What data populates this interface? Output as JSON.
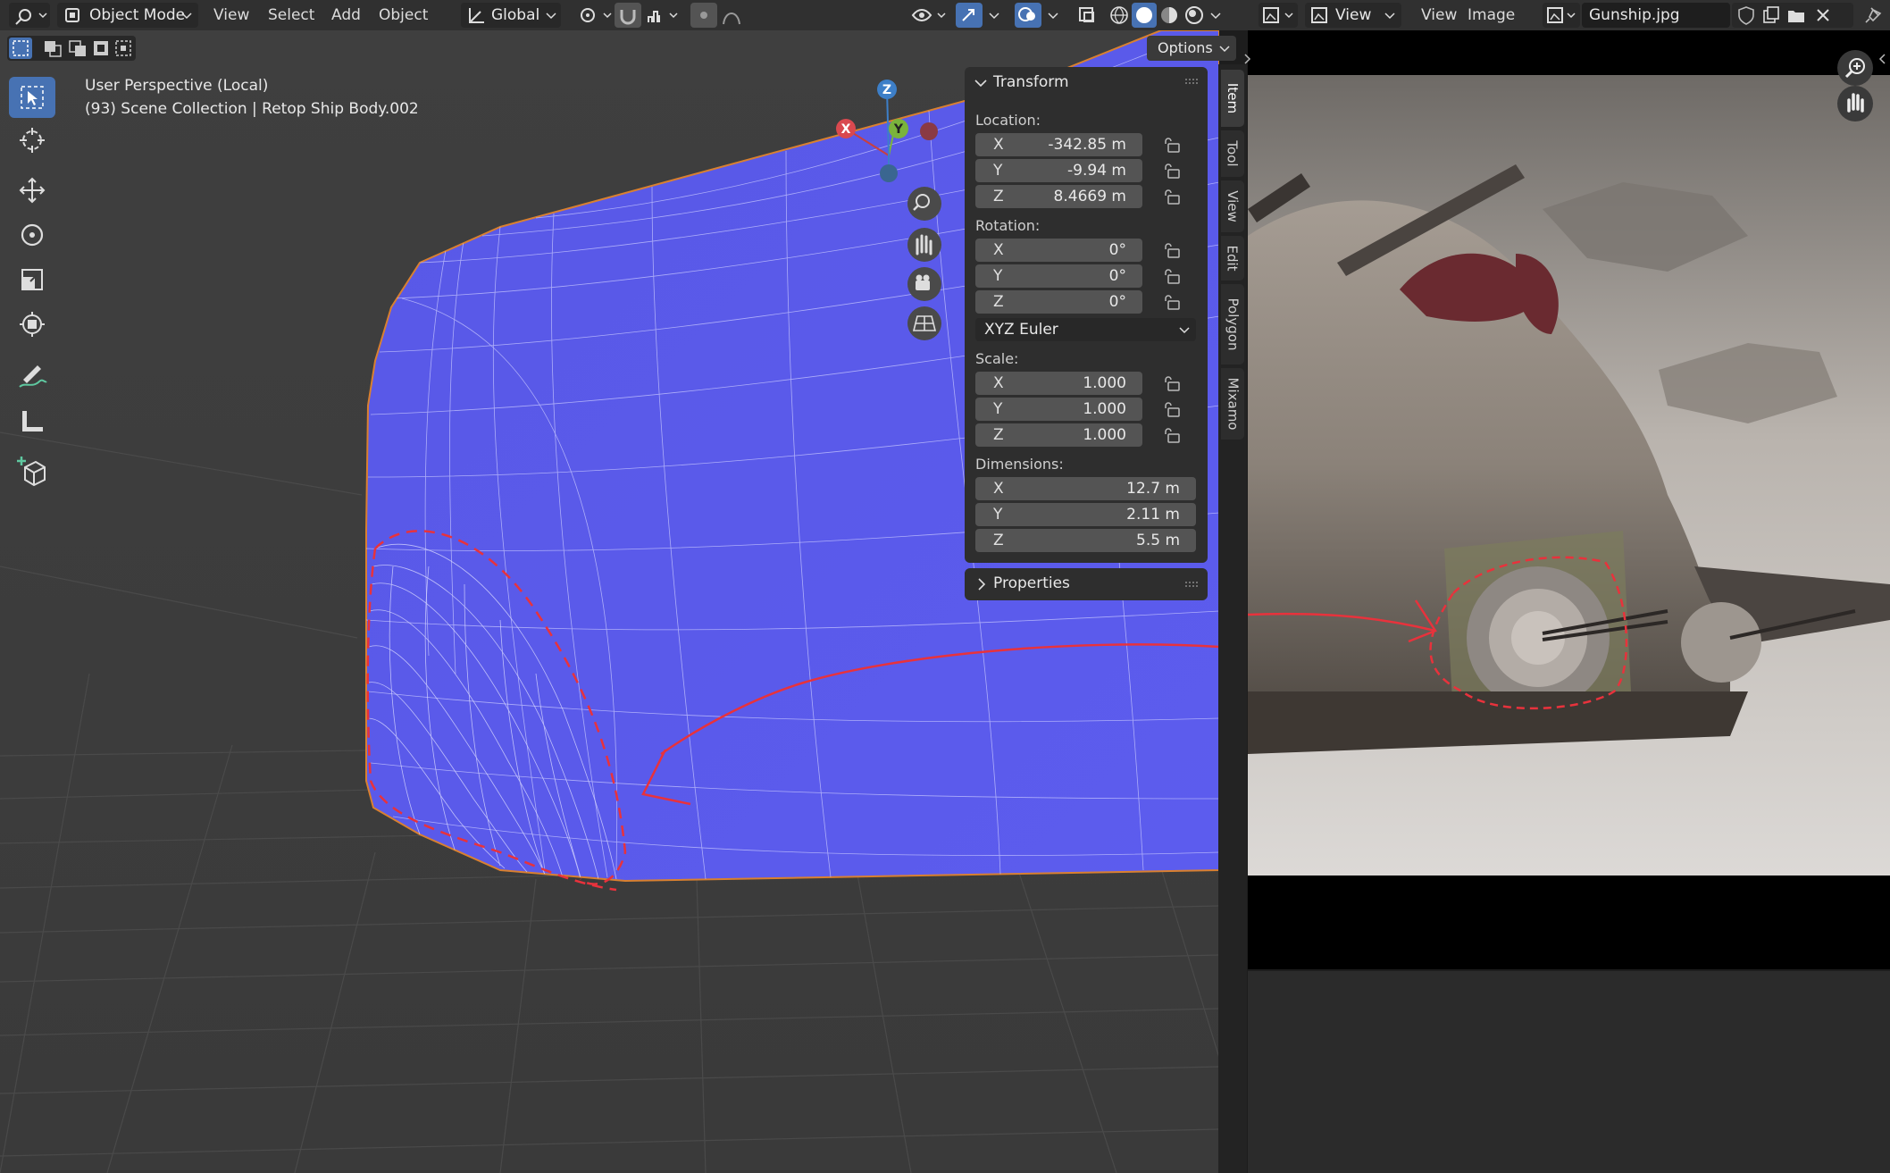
{
  "header": {
    "mode": "Object Mode",
    "menu": [
      "View",
      "Select",
      "Add",
      "Object"
    ],
    "orientation": "Global"
  },
  "viewport": {
    "perspective": "User Perspective (Local)",
    "collection": "(93) Scene Collection | Retop Ship Body.002",
    "options_label": "Options",
    "gizmo": {
      "x": "X",
      "y": "Y",
      "z": "Z"
    }
  },
  "tools": [
    "select-box",
    "cursor",
    "move",
    "rotate",
    "scale",
    "transform",
    "annotate",
    "measure",
    "add-cube"
  ],
  "npanel": {
    "transform_title": "Transform",
    "location_label": "Location:",
    "location": [
      {
        "axis": "X",
        "value": "-342.85 m"
      },
      {
        "axis": "Y",
        "value": "-9.94 m"
      },
      {
        "axis": "Z",
        "value": "8.4669 m"
      }
    ],
    "rotation_label": "Rotation:",
    "rotation": [
      {
        "axis": "X",
        "value": "0°"
      },
      {
        "axis": "Y",
        "value": "0°"
      },
      {
        "axis": "Z",
        "value": "0°"
      }
    ],
    "rotation_mode": "XYZ Euler",
    "scale_label": "Scale:",
    "scale": [
      {
        "axis": "X",
        "value": "1.000"
      },
      {
        "axis": "Y",
        "value": "1.000"
      },
      {
        "axis": "Z",
        "value": "1.000"
      }
    ],
    "dimensions_label": "Dimensions:",
    "dimensions": [
      {
        "axis": "X",
        "value": "12.7 m"
      },
      {
        "axis": "Y",
        "value": "2.11 m"
      },
      {
        "axis": "Z",
        "value": "5.5 m"
      }
    ],
    "properties_title": "Properties"
  },
  "sidebar_tabs": [
    "Item",
    "Tool",
    "View",
    "Edit",
    "Polygon",
    "Mixamo"
  ],
  "image_editor": {
    "menu_view": "View",
    "menu_view2": "View",
    "menu_image": "Image",
    "image_name": "Gunship.jpg"
  },
  "colors": {
    "mesh": "#5a5aeb",
    "annotation": "#e8323c",
    "active_tool": "#4772b3"
  }
}
